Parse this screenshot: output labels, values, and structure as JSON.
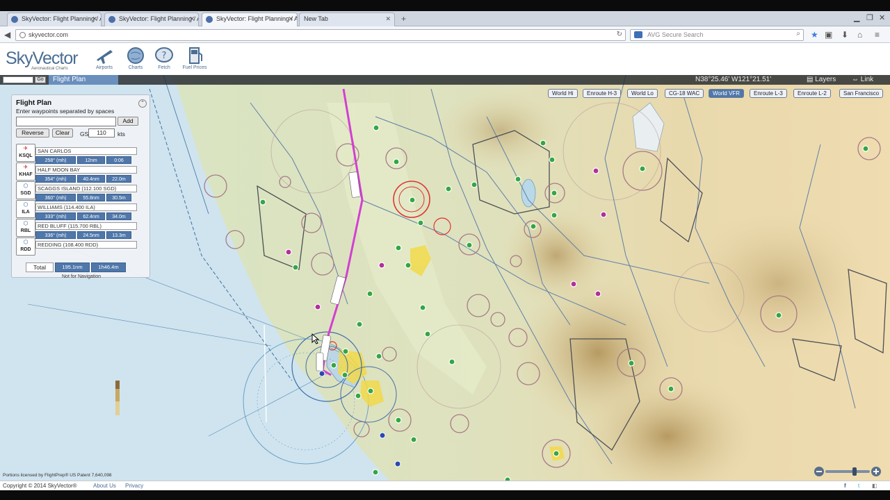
{
  "browser": {
    "tabs": [
      {
        "label": "SkyVector: Flight Planning / A..."
      },
      {
        "label": "SkyVector: Flight Planning / A..."
      },
      {
        "label": "SkyVector: Flight Planning / A..."
      },
      {
        "label": "New Tab"
      }
    ],
    "url": "skyvector.com",
    "search_placeholder": "AVG Secure Search"
  },
  "site": {
    "logo": "SkyVector",
    "logo_sub": "Aeronautical Charts",
    "nav": [
      {
        "label": "Airports",
        "icon": "airplane-icon"
      },
      {
        "label": "Charts",
        "icon": "globe-icon"
      },
      {
        "label": "Fetch",
        "icon": "question-bubble-icon"
      },
      {
        "label": "Fuel Prices",
        "icon": "fuel-pump-icon"
      }
    ]
  },
  "map_toolbar": {
    "go_label": "Go",
    "flight_plan_tab": "Flight Plan",
    "coordinates": "N38°25.46' W121°21.51'",
    "layers": "Layers",
    "link": "Link"
  },
  "chart_buttons": [
    {
      "label": "World Hi",
      "selected": false
    },
    {
      "label": "Enroute H-3",
      "selected": false
    },
    {
      "label": "World Lo",
      "selected": false
    },
    {
      "label": "CG-18 WAC",
      "selected": false
    },
    {
      "label": "World VFR",
      "selected": true
    },
    {
      "label": "Enroute L-3",
      "selected": false
    },
    {
      "label": "Enroute L-2",
      "selected": false
    },
    {
      "label": "San Francisco",
      "selected": false
    }
  ],
  "flight_plan": {
    "title": "Flight Plan",
    "subtitle": "Enter waypoints separated by spaces",
    "input_value": "",
    "add_label": "Add",
    "reverse_label": "Reverse",
    "clear_label": "Clear",
    "gs_label": "GS",
    "gs_value": "110",
    "kts_label": "kts",
    "waypoints": [
      {
        "id": "KSQL",
        "name": "SAN CARLOS"
      },
      {
        "id": "KHAF",
        "name": "HALF MOON BAY"
      },
      {
        "id": "SGD",
        "name": "SCAGGS ISLAND (112.100 SGD)"
      },
      {
        "id": "ILA",
        "name": "WILLIAMS (114.400 ILA)"
      },
      {
        "id": "RBL",
        "name": "RED BLUFF (115.700 RBL)"
      },
      {
        "id": "RDD",
        "name": "REDDING (108.400 RDD)"
      }
    ],
    "legs": [
      {
        "course": "258° (mh)",
        "dist": "12nm",
        "time": "0:06"
      },
      {
        "course": "354° (mh)",
        "dist": "40.4nm",
        "time": "22.0m"
      },
      {
        "course": "360° (mh)",
        "dist": "55.8nm",
        "time": "30.5m"
      },
      {
        "course": "333° (mh)",
        "dist": "62.4nm",
        "time": "34.0m"
      },
      {
        "course": "336° (mh)",
        "dist": "24.5nm",
        "time": "13.3m"
      }
    ],
    "total_label": "Total",
    "total_dist": "195.1nm",
    "total_time": "1h46.4m",
    "not_for_nav": "Not for Navigation"
  },
  "map_footer_note": "Portions licensed by FlightPrep® US Patent 7,640,098",
  "page_footer": {
    "copyright": "Copyright © 2014 SkyVector®",
    "about": "About Us",
    "privacy": "Privacy"
  },
  "colors": {
    "route": "#d23fd2",
    "airport_green": "#2fa43a",
    "airport_magenta": "#b0309a",
    "brand": "#4a6d93",
    "panel_accent": "#4f77aa"
  }
}
